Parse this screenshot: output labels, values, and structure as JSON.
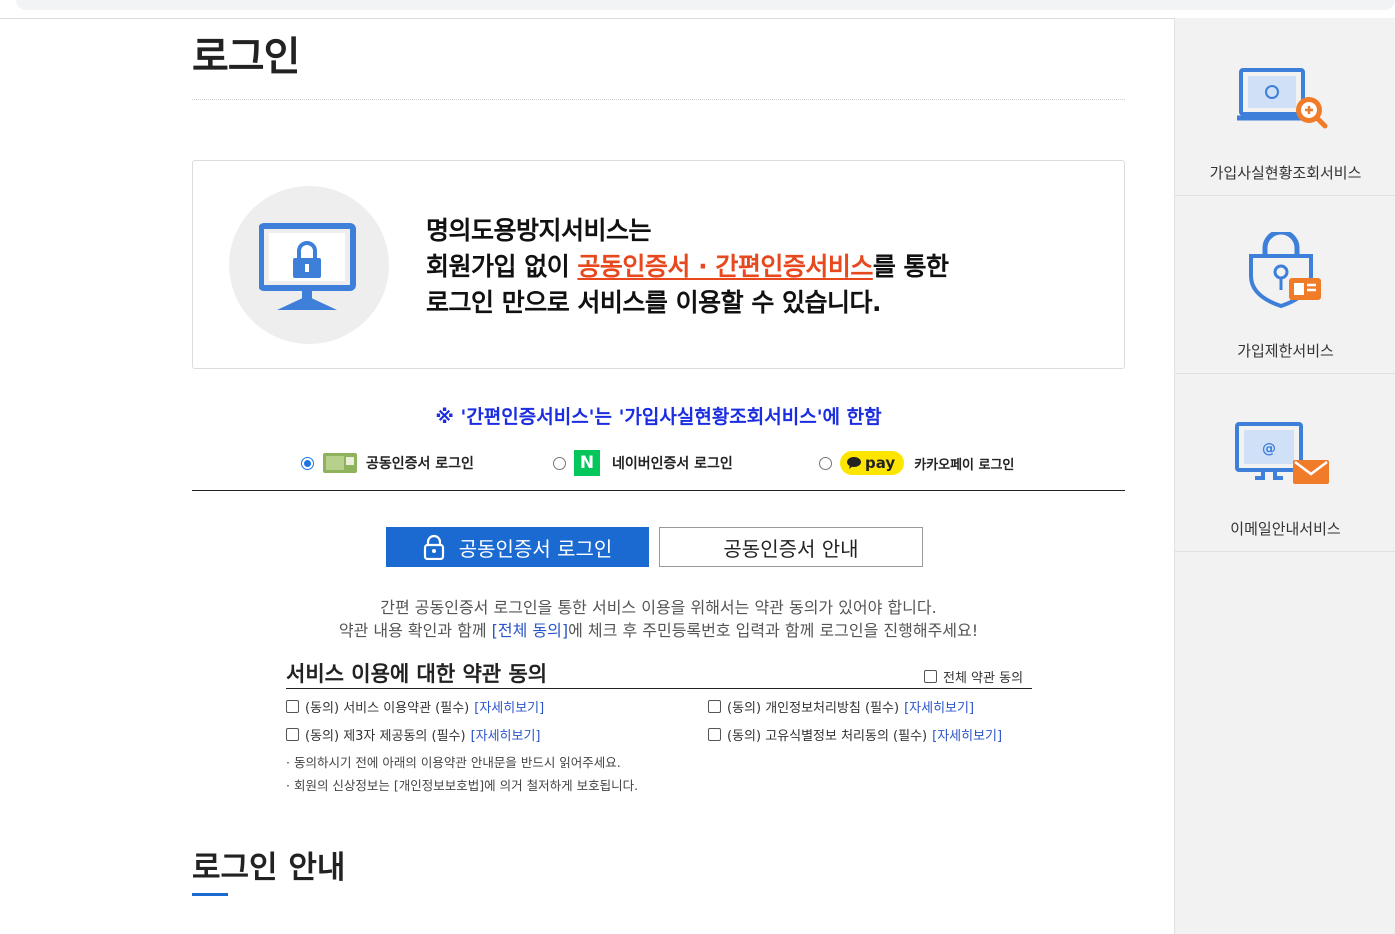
{
  "page": {
    "title": "로그인"
  },
  "info": {
    "line1": "명의도용방지서비스는",
    "line2_pre": "회원가입 없이 ",
    "line2_highlight": "공동인증서 · 간편인증서비스",
    "line2_post": "를 통한",
    "line3": "로그인 만으로 서비스를 이용할 수 있습니다."
  },
  "notice": "※ '간편인증서비스'는 '가입사실현황조회서비스'에 한함",
  "auth_options": [
    {
      "label": "공동인증서 로그인",
      "selected": true,
      "icon": "certificate-card-icon"
    },
    {
      "label": "네이버인증서 로그인",
      "selected": false,
      "icon": "naver-n-icon"
    },
    {
      "label": "카카오페이 로그인",
      "selected": false,
      "icon": "kakaopay-icon"
    }
  ],
  "kakao_badge": "pay",
  "naver_badge": "N",
  "buttons": {
    "login": "공동인증서 로그인",
    "guide": "공동인증서 안내"
  },
  "desc": {
    "line1": "간편 공동인증서 로그인을 통한 서비스 이용을 위해서는 약관 동의가 있어야 합니다.",
    "line2_pre": "약관 내용 확인과 함께 ",
    "line2_link": "[전체 동의]",
    "line2_post": "에 체크 후 주민등록번호 입력과 함께 로그인을 진행해주세요!"
  },
  "terms": {
    "title": "서비스 이용에 대한 약관 동의",
    "all_agree": "전체 약관 동의",
    "items": [
      {
        "label": "(동의) 서비스 이용약관 (필수)",
        "link": "[자세히보기]"
      },
      {
        "label": "(동의) 개인정보처리방침 (필수)",
        "link": "[자세히보기]"
      },
      {
        "label": "(동의) 제3자 제공동의 (필수)",
        "link": "[자세히보기]"
      },
      {
        "label": "(동의) 고유식별정보 처리동의 (필수)",
        "link": "[자세히보기]"
      }
    ],
    "notes": [
      "· 동의하시기 전에 아래의 이용약관 안내문을 반드시 읽어주세요.",
      "· 회원의 신상정보는 [개인정보보호법]에 의거 철저하게 보호됩니다."
    ]
  },
  "guide": {
    "title": "로그인 안내"
  },
  "sidebar": {
    "items": [
      {
        "label": "가입사실현황조회서비스",
        "icon": "monitor-search-icon"
      },
      {
        "label": "가입제한서비스",
        "icon": "lock-shield-icon"
      },
      {
        "label": "이메일안내서비스",
        "icon": "monitor-email-icon"
      }
    ]
  },
  "colors": {
    "accent_blue": "#1a6ad2",
    "highlight_red": "#e8481d",
    "notice_blue": "#1b2de0",
    "icon_blue": "#3d7fd9",
    "icon_orange": "#f07c2a"
  }
}
